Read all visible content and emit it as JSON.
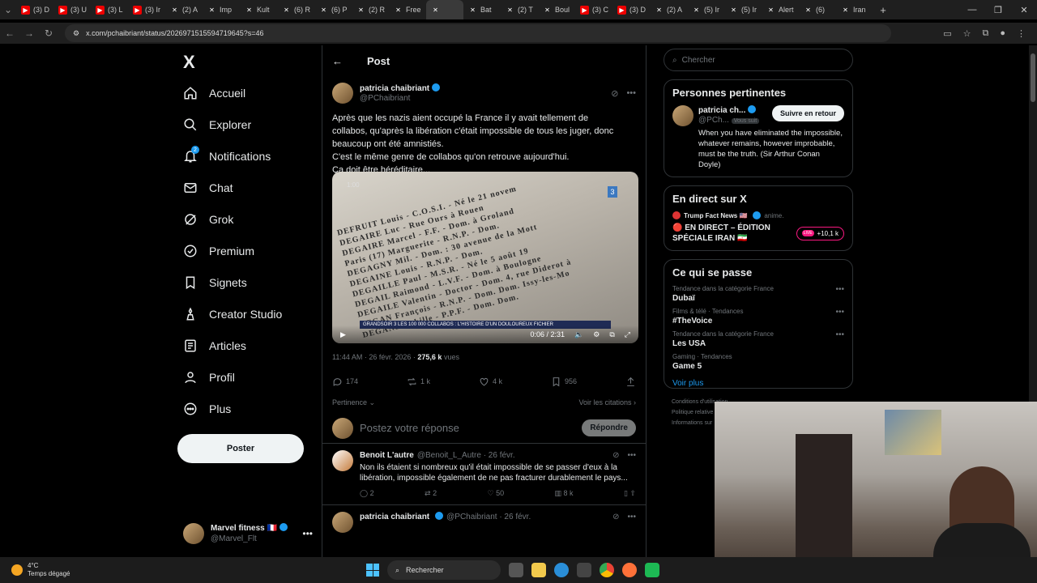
{
  "browser": {
    "tabs": [
      {
        "label": "(3) D",
        "fav": "yt"
      },
      {
        "label": "(3) U",
        "fav": "yt"
      },
      {
        "label": "(3) L",
        "fav": "yt"
      },
      {
        "label": "(3) Ir",
        "fav": "yt"
      },
      {
        "label": "(2) A",
        "fav": "x"
      },
      {
        "label": "Imp",
        "fav": "x"
      },
      {
        "label": "Kult",
        "fav": "x"
      },
      {
        "label": "(6) R",
        "fav": "x"
      },
      {
        "label": "(6) P",
        "fav": "x"
      },
      {
        "label": "(2) R",
        "fav": "x"
      },
      {
        "label": "Free",
        "fav": "x"
      },
      {
        "label": "",
        "fav": "x",
        "active": true
      },
      {
        "label": "Bat",
        "fav": "x"
      },
      {
        "label": "(2) T",
        "fav": "x"
      },
      {
        "label": "Boul",
        "fav": "x"
      },
      {
        "label": "(3) C",
        "fav": "yt"
      },
      {
        "label": "(3) D",
        "fav": "yt"
      },
      {
        "label": "(2) A",
        "fav": "x"
      },
      {
        "label": "(5) Ir",
        "fav": "x"
      },
      {
        "label": "(5) Ir",
        "fav": "x"
      },
      {
        "label": "Alert",
        "fav": "x"
      },
      {
        "label": "(6)",
        "fav": "x"
      },
      {
        "label": "Iran",
        "fav": "x"
      }
    ],
    "url": "x.com/pchaibriant/status/2026971515594719645?s=46"
  },
  "sidebar": {
    "logo": "X",
    "items": [
      {
        "label": "Accueil",
        "icon": "home-icon"
      },
      {
        "label": "Explorer",
        "icon": "search-icon"
      },
      {
        "label": "Notifications",
        "icon": "bell-icon",
        "badge": "2"
      },
      {
        "label": "Chat",
        "icon": "mail-icon"
      },
      {
        "label": "Grok",
        "icon": "grok-icon"
      },
      {
        "label": "Premium",
        "icon": "premium-icon"
      },
      {
        "label": "Signets",
        "icon": "bookmark-icon"
      },
      {
        "label": "Creator Studio",
        "icon": "studio-icon"
      },
      {
        "label": "Articles",
        "icon": "articles-icon"
      },
      {
        "label": "Profil",
        "icon": "user-icon"
      },
      {
        "label": "Plus",
        "icon": "more-icon"
      }
    ],
    "post_label": "Poster",
    "account": {
      "name": "Marvel fitness 🇫🇷",
      "handle": "@Marvel_Flt"
    }
  },
  "post": {
    "header": "Post",
    "author_name": "patricia chaibriant",
    "author_handle": "@PChaibriant",
    "text_lines": [
      "Après que les nazis aient occupé la France il y avait tellement de",
      "collabos, qu'après la libération c'était impossible de tous les juger, donc",
      "beaucoup ont été amnistiés.",
      "C'est le même genre de collabos qu'on retrouve aujourd'hui.",
      "Ça doit être héréditaire..."
    ],
    "video": {
      "tag": "1:00",
      "channel": "3",
      "banner": "GRANDSOIR 3  LES 100 000 COLLABOS : L'HISTOIRE D'UN DOULOUREUX FICHIER",
      "time": "0:06 / 2:31",
      "doc_lines": [
        "DEFRUIT Louis - C.O.S.I. - Né le 21 novem",
        "DEGAIRE Luc - Rue Ours à Rouen",
        "DEGAIRE Marcel - F.F. - Dom. à Groland",
        "Paris (17) Marguerite - R.N.P. - Dom.",
        "DEGAGNY Mil. - Dom. : 30 avenue de la Mott",
        "DEGAINE Louis - R.N.P. - Dom.",
        "DEGAILLE Paul - M.S.R. - Né le 5 août 19",
        "DEGAIL Raimond - L.V.F. - Dom. à Boulogne",
        "DEGAILE Valentin - Doctor - Dom. 4, rue Diderot à",
        "DEGAN François - R.N.P. - Dom. Dom. Issy-les-Mo",
        "DEGAND Achille - P.P.F. - Dom. Dom."
      ]
    },
    "meta_time": "11:44 AM · 26 févr. 2026 · ",
    "meta_views": "275,6 k",
    "meta_views_label": " vues",
    "stats": {
      "replies": "174",
      "reposts": "1 k",
      "likes": "4 k",
      "bookmarks": "956"
    },
    "sort_label": "Pertinence",
    "citations_label": "Voir les citations",
    "reply_placeholder": "Postez votre réponse",
    "reply_button": "Répondre"
  },
  "replies": [
    {
      "name": "Benoit L'autre",
      "handle": "@Benoit_L_Autre · 26 févr.",
      "text": "Non ils étaient si nombreux qu'il était impossible de se passer d'eux à la libération, impossible également de ne pas fracturer durablement le pays...",
      "stats": {
        "replies": "2",
        "reposts": "2",
        "likes": "50",
        "views": "8 k"
      }
    },
    {
      "name": "patricia chaibriant",
      "handle": "@PChaibriant · 26 févr.",
      "text": "",
      "stats": {}
    }
  ],
  "right": {
    "search_placeholder": "Chercher",
    "relevant": {
      "title": "Personnes pertinentes",
      "name": "patricia ch...",
      "handle": "@PCh...",
      "follows_you": "Vous suit",
      "follow_label": "Suivre en retour",
      "bio": "When you have eliminated the impossible, whatever remains, however improbable, must be the truth. (Sir Arthur Conan Doyle)"
    },
    "live": {
      "title": "En direct sur X",
      "host": "Trump Fact News 🇺🇸",
      "host_suffix": "anime.",
      "event": "🔴 EN DIRECT – ÉDITION SPÉCIALE IRAN 🇮🇷",
      "count": "+10,1 k",
      "live_tag": "LIVE"
    },
    "trends": {
      "title": "Ce qui se passe",
      "items": [
        {
          "context": "Tendance dans la catégorie France",
          "name": "Dubaï"
        },
        {
          "context": "Films & télé · Tendances",
          "name": "#TheVoice"
        },
        {
          "context": "Tendance dans la catégorie France",
          "name": "Les USA"
        },
        {
          "context": "Gaming · Tendances",
          "name": "Game 5"
        }
      ],
      "more_label": "Voir plus"
    },
    "footer": [
      "Conditions d'utilisation",
      "Politique relative",
      "Informations sur"
    ]
  },
  "taskbar": {
    "temp": "4°C",
    "weather": "Temps dégagé",
    "search_label": "Rechercher"
  }
}
